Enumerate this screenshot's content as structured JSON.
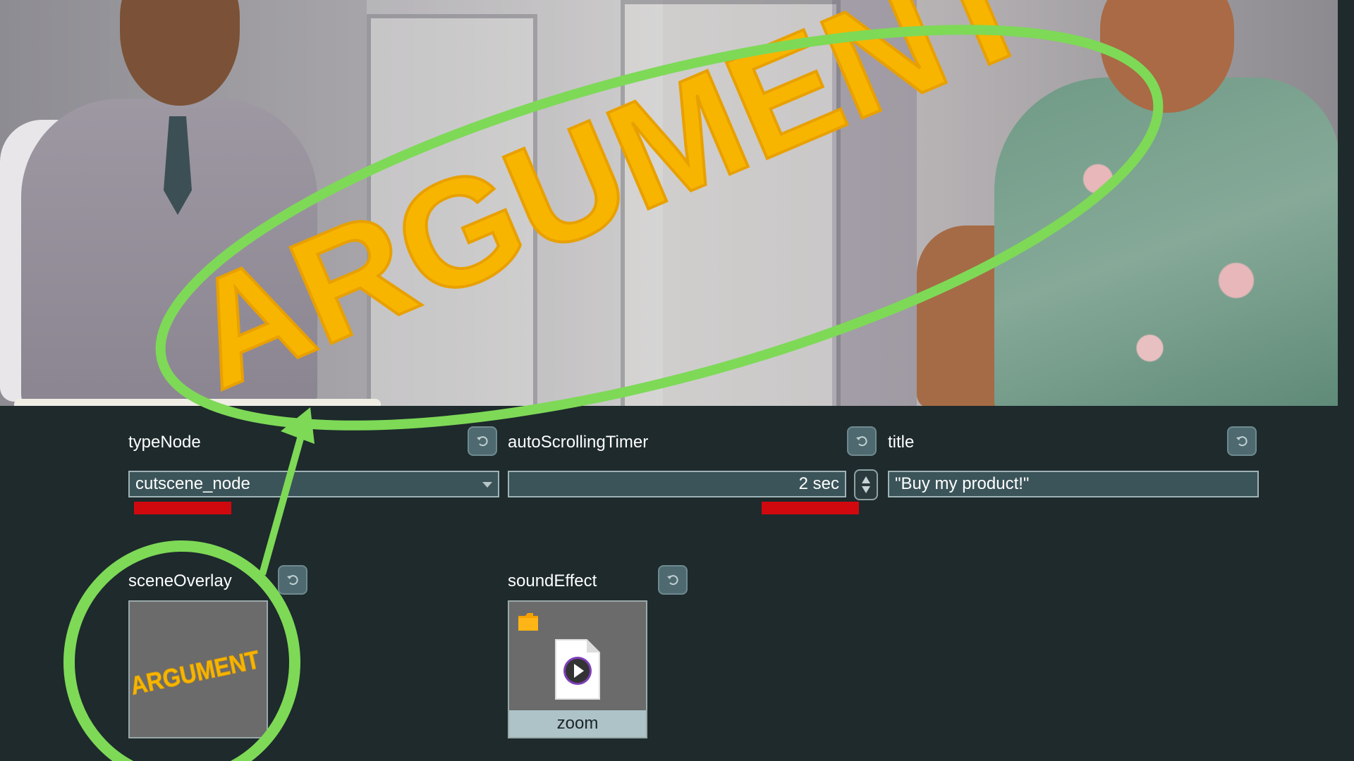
{
  "scene": {
    "banner_text": "ARGUMENT"
  },
  "fields": {
    "type_node": {
      "label": "typeNode",
      "value": "cutscene_node"
    },
    "auto_scrolling_timer": {
      "label": "autoScrollingTimer",
      "value": "2 sec"
    },
    "title": {
      "label": "title",
      "value": "\"Buy my product!\""
    },
    "scene_overlay": {
      "label": "sceneOverlay",
      "thumbnail_text": "ARGUMENT"
    },
    "sound_effect": {
      "label": "soundEffect",
      "file_name": "zoom"
    }
  },
  "colors": {
    "panel_bg": "#1e2a2c",
    "field_bg": "#3b5459",
    "accent_green": "#7ed957",
    "banner_yellow": "#f7b500",
    "error_red": "#d0090f"
  },
  "icons": [
    "revert-icon",
    "chevron-down-icon",
    "spinner-arrows-icon",
    "folder-icon",
    "audio-file-icon"
  ]
}
